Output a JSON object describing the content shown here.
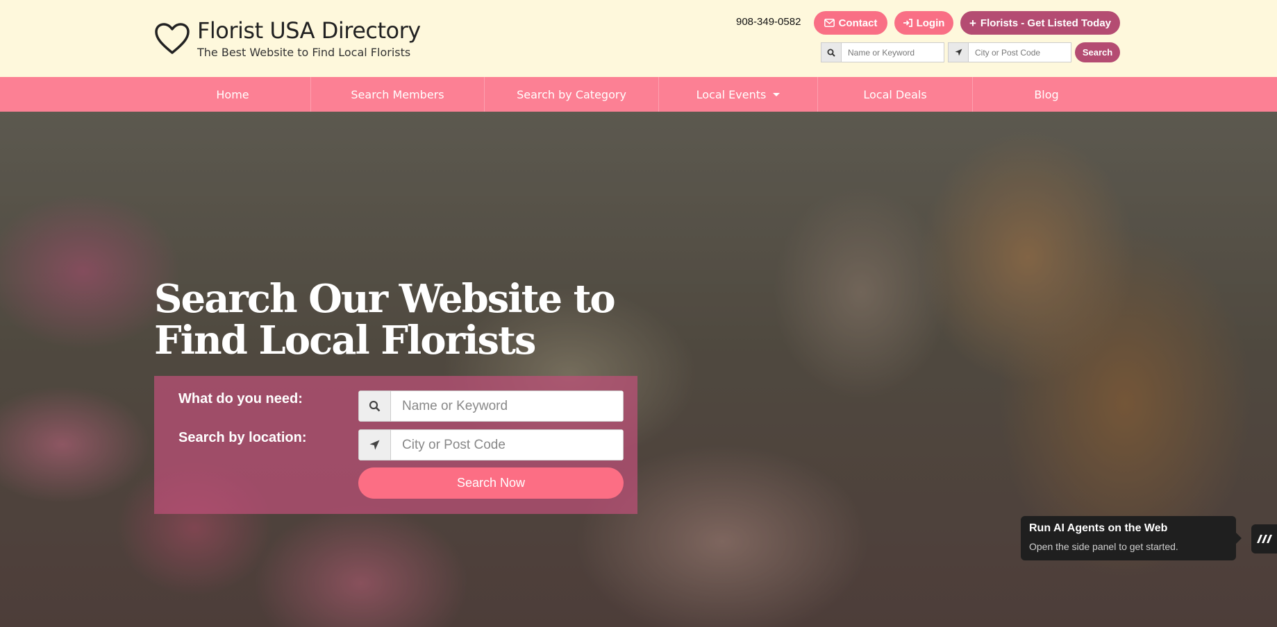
{
  "header": {
    "site_title": "Florist USA Directory",
    "tagline": "The Best Website to Find Local Florists",
    "phone": "908-349-0582",
    "contact_label": "Contact",
    "login_label": "Login",
    "get_listed_label": "Florists - Get Listed Today",
    "search": {
      "keyword_placeholder": "Name or Keyword",
      "location_placeholder": "City or Post Code",
      "button_label": "Search"
    }
  },
  "nav": {
    "items": [
      {
        "label": "Home"
      },
      {
        "label": "Search Members"
      },
      {
        "label": "Search by Category"
      },
      {
        "label": "Local Events"
      },
      {
        "label": "Local Deals"
      },
      {
        "label": "Blog"
      }
    ]
  },
  "hero": {
    "title": "Search Our Website to Find Local Florists",
    "need_label": "What do you need:",
    "location_label": "Search by location:",
    "keyword_placeholder": "Name or Keyword",
    "location_placeholder": "City or Post Code",
    "button_label": "Search Now"
  },
  "toast": {
    "title": "Run AI Agents on the Web",
    "body": "Open the side panel to get started."
  },
  "colors": {
    "header_bg": "#fef8dc",
    "nav_bg": "#fc8094",
    "pill_pink": "#f96f85",
    "pill_dark": "#b44c72",
    "panel": "#be5078"
  }
}
